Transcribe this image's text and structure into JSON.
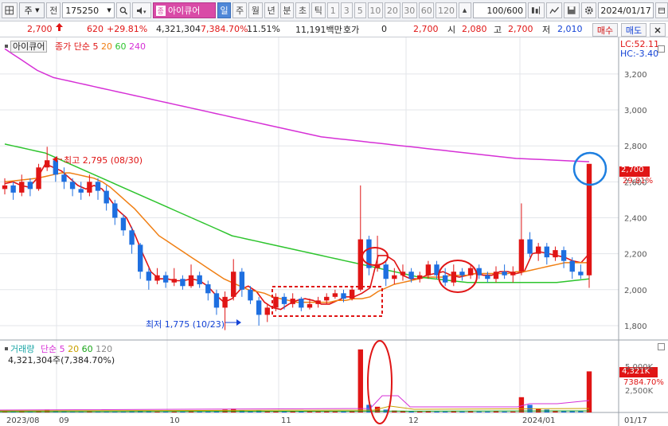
{
  "toolbar": {
    "icon_left": "grid-icon",
    "prefix1": "주",
    "prefix2": "전",
    "code": "175250",
    "name": "아이큐어",
    "periods": [
      "일",
      "주",
      "월",
      "년",
      "분",
      "초",
      "틱"
    ],
    "numbers": [
      "1",
      "3",
      "5",
      "10",
      "20",
      "30",
      "60",
      "120"
    ],
    "count": "100",
    "count_total": "/600",
    "date": "2024/01/17"
  },
  "info": {
    "price": "2,700",
    "change": "620",
    "change_pct": "+29.81%",
    "volume": "4,321,304",
    "volume_pct": "7,384.70%",
    "turnover": "11.51%",
    "amount": "11,191백만",
    "hoga_label": "호가",
    "hoga_value": "0",
    "hoga_price": "2,700",
    "open_label": "시",
    "open": "2,080",
    "high_label": "고",
    "high": "2,700",
    "low_label": "저",
    "low": "2,010",
    "buy": "매수",
    "sell": "매도"
  },
  "price_panel": {
    "stock_label": "아이큐어",
    "ma_label": "종가 단순",
    "ma_periods": [
      {
        "label": "5",
        "color": "#e01515"
      },
      {
        "label": "20",
        "color": "#f07f13"
      },
      {
        "label": "60",
        "color": "#2dc42d"
      },
      {
        "label": "240",
        "color": "#d630d6"
      }
    ],
    "lc": "LC:52.11",
    "hc": "HC:-3.40",
    "high_note": "최고 2,795 (08/30)",
    "low_note": "최저 1,775 (10/23)",
    "current_tag": "2,700",
    "current_pct": "29.81%"
  },
  "volume_panel": {
    "label": "거래량",
    "ma_label": "단순",
    "ma_periods": [
      {
        "label": "5",
        "color": "#d630d6"
      },
      {
        "label": "20",
        "color": "#c9a100"
      },
      {
        "label": "60",
        "color": "#1aa51a"
      },
      {
        "label": "120",
        "color": "#888888"
      }
    ],
    "summary": "4,321,304주(7,384.70%)",
    "tag_value": "4,321K",
    "tag_pct": "7384.70%"
  },
  "x_axis": [
    "2023/08",
    "09",
    "10",
    "11",
    "12",
    "2024/01",
    "01/17"
  ],
  "chart_data": {
    "type": "candlestick",
    "y_ticks": [
      1800,
      2000,
      2200,
      2400,
      2600,
      2800,
      3000,
      3200
    ],
    "y_tick_labels": [
      "1,800",
      "2,000",
      "2,200",
      "2,400",
      "2,600",
      "2,800",
      "3,000",
      "3,200"
    ],
    "vol_ticks": [
      "2,500K",
      "5,000K"
    ],
    "price_range": [
      1720,
      3390
    ],
    "series": [
      {
        "name": "5",
        "values": [
          2590,
          2600,
          2580,
          2570,
          2620,
          2700,
          2680,
          2660,
          2620,
          2580,
          2560,
          2580,
          2560,
          2500,
          2440,
          2400,
          2310,
          2200,
          2100,
          2060,
          2060,
          2050,
          2050,
          2060,
          2050,
          2020,
          1970,
          1930,
          1950,
          2000,
          2020,
          1990,
          1930,
          1900,
          1890,
          1920,
          1940,
          1950,
          1940,
          1920,
          1920,
          1940,
          1960,
          1960,
          1980,
          2010,
          2190,
          2190,
          2160,
          2080,
          2060,
          2060,
          2080,
          2090,
          2100,
          2080,
          2070,
          2080,
          2090,
          2080,
          2080,
          2100,
          2100,
          2090,
          2100,
          2200,
          2210,
          2200,
          2190,
          2180,
          2160,
          2150,
          2200
        ]
      },
      {
        "name": "20",
        "values": [
          2600,
          2605,
          2610,
          2615,
          2620,
          2630,
          2640,
          2650,
          2650,
          2640,
          2630,
          2620,
          2600,
          2570,
          2530,
          2490,
          2450,
          2400,
          2350,
          2300,
          2270,
          2240,
          2210,
          2180,
          2150,
          2120,
          2090,
          2060,
          2040,
          2020,
          2000,
          1990,
          1980,
          1960,
          1950,
          1940,
          1930,
          1930,
          1930,
          1930,
          1930,
          1940,
          1940,
          1950,
          1950,
          1960,
          1990,
          2010,
          2030,
          2040,
          2050,
          2060,
          2070,
          2070,
          2070,
          2080,
          2080,
          2080,
          2090,
          2090,
          2090,
          2090,
          2090,
          2100,
          2100,
          2110,
          2120,
          2130,
          2140,
          2150,
          2150,
          2150,
          2150
        ]
      },
      {
        "name": "60",
        "values": [
          2810,
          2800,
          2790,
          2780,
          2770,
          2760,
          2740,
          2720,
          2700,
          2680,
          2660,
          2640,
          2620,
          2600,
          2580,
          2560,
          2540,
          2520,
          2500,
          2480,
          2460,
          2440,
          2420,
          2400,
          2380,
          2360,
          2340,
          2320,
          2300,
          2290,
          2280,
          2270,
          2260,
          2250,
          2240,
          2230,
          2220,
          2210,
          2200,
          2190,
          2180,
          2170,
          2160,
          2150,
          2140,
          2130,
          2120,
          2110,
          2100,
          2090,
          2080,
          2070,
          2065,
          2060,
          2055,
          2050,
          2045,
          2040,
          2040,
          2040,
          2040,
          2040,
          2040,
          2040,
          2040,
          2040,
          2040,
          2040,
          2040,
          2045,
          2050,
          2055,
          2060
        ]
      },
      {
        "name": "240",
        "values": [
          3340,
          3310,
          3280,
          3250,
          3220,
          3200,
          3180,
          3170,
          3160,
          3150,
          3140,
          3130,
          3120,
          3110,
          3100,
          3090,
          3080,
          3070,
          3060,
          3050,
          3040,
          3030,
          3020,
          3010,
          3000,
          2990,
          2980,
          2970,
          2960,
          2950,
          2940,
          2930,
          2920,
          2910,
          2900,
          2890,
          2880,
          2870,
          2860,
          2850,
          2845,
          2840,
          2835,
          2830,
          2825,
          2820,
          2815,
          2810,
          2805,
          2800,
          2795,
          2790,
          2785,
          2780,
          2775,
          2770,
          2765,
          2760,
          2755,
          2750,
          2745,
          2740,
          2735,
          2730,
          2728,
          2726,
          2724,
          2722,
          2720,
          2718,
          2716,
          2714,
          2712
        ]
      }
    ],
    "candles": [
      [
        2560,
        2580,
        2620,
        2530
      ],
      [
        2580,
        2540,
        2600,
        2500
      ],
      [
        2540,
        2600,
        2640,
        2520
      ],
      [
        2600,
        2560,
        2620,
        2520
      ],
      [
        2560,
        2680,
        2700,
        2550
      ],
      [
        2680,
        2720,
        2795,
        2660
      ],
      [
        2720,
        2640,
        2740,
        2600
      ],
      [
        2640,
        2600,
        2680,
        2560
      ],
      [
        2600,
        2560,
        2620,
        2520
      ],
      [
        2560,
        2540,
        2600,
        2500
      ],
      [
        2540,
        2600,
        2640,
        2520
      ],
      [
        2600,
        2550,
        2620,
        2500
      ],
      [
        2550,
        2480,
        2580,
        2440
      ],
      [
        2480,
        2400,
        2500,
        2360
      ],
      [
        2400,
        2330,
        2420,
        2300
      ],
      [
        2330,
        2250,
        2350,
        2200
      ],
      [
        2250,
        2100,
        2260,
        2060
      ],
      [
        2100,
        2050,
        2120,
        2000
      ],
      [
        2050,
        2080,
        2120,
        2030
      ],
      [
        2080,
        2040,
        2100,
        2010
      ],
      [
        2040,
        2060,
        2120,
        2020
      ],
      [
        2060,
        2020,
        2080,
        2000
      ],
      [
        2020,
        2080,
        2140,
        2010
      ],
      [
        2080,
        2030,
        2100,
        2010
      ],
      [
        2030,
        1980,
        2050,
        1940
      ],
      [
        1980,
        1900,
        2000,
        1860
      ],
      [
        1900,
        1960,
        1990,
        1775
      ],
      [
        1960,
        2100,
        2170,
        1940
      ],
      [
        2100,
        2000,
        2120,
        1960
      ],
      [
        2000,
        1940,
        2020,
        1920
      ],
      [
        1940,
        1860,
        1960,
        1800
      ],
      [
        1860,
        1900,
        1920,
        1820
      ],
      [
        1900,
        1960,
        1980,
        1880
      ],
      [
        1960,
        1920,
        1980,
        1890
      ],
      [
        1920,
        1950,
        1980,
        1900
      ],
      [
        1950,
        1900,
        1960,
        1880
      ],
      [
        1900,
        1920,
        1950,
        1890
      ],
      [
        1920,
        1940,
        1960,
        1900
      ],
      [
        1940,
        1960,
        1980,
        1920
      ],
      [
        1960,
        1980,
        2000,
        1950
      ],
      [
        1980,
        1950,
        2000,
        1930
      ],
      [
        1950,
        2000,
        2020,
        1940
      ],
      [
        2000,
        2280,
        2580,
        1990
      ],
      [
        2280,
        2120,
        2300,
        2080
      ],
      [
        2120,
        2140,
        2300,
        2100
      ],
      [
        2140,
        2060,
        2160,
        2020
      ],
      [
        2060,
        2080,
        2120,
        2030
      ],
      [
        2080,
        2100,
        2140,
        2050
      ],
      [
        2100,
        2060,
        2120,
        2040
      ],
      [
        2060,
        2080,
        2100,
        2040
      ],
      [
        2080,
        2140,
        2160,
        2060
      ],
      [
        2140,
        2080,
        2160,
        2060
      ],
      [
        2080,
        2040,
        2120,
        2020
      ],
      [
        2040,
        2100,
        2140,
        2020
      ],
      [
        2100,
        2080,
        2120,
        2050
      ],
      [
        2080,
        2120,
        2140,
        2060
      ],
      [
        2120,
        2080,
        2140,
        2060
      ],
      [
        2080,
        2060,
        2100,
        2040
      ],
      [
        2060,
        2100,
        2130,
        2040
      ],
      [
        2100,
        2080,
        2140,
        2060
      ],
      [
        2080,
        2100,
        2130,
        2040
      ],
      [
        2100,
        2280,
        2480,
        2080
      ],
      [
        2280,
        2200,
        2320,
        2180
      ],
      [
        2200,
        2240,
        2260,
        2160
      ],
      [
        2240,
        2180,
        2260,
        2140
      ],
      [
        2180,
        2220,
        2240,
        2160
      ],
      [
        2220,
        2160,
        2240,
        2120
      ],
      [
        2160,
        2100,
        2180,
        2060
      ],
      [
        2100,
        2080,
        2140,
        2060
      ],
      [
        2080,
        2700,
        2700,
        2010
      ]
    ],
    "volumes": [
      0.15,
      0.12,
      0.18,
      0.1,
      0.2,
      0.3,
      0.2,
      0.15,
      0.12,
      0.1,
      0.15,
      0.12,
      0.1,
      0.12,
      0.1,
      0.15,
      0.2,
      0.15,
      0.12,
      0.1,
      0.12,
      0.1,
      0.15,
      0.1,
      0.12,
      0.15,
      0.3,
      0.4,
      0.25,
      0.15,
      0.2,
      0.12,
      0.12,
      0.1,
      0.1,
      0.1,
      0.08,
      0.08,
      0.1,
      0.1,
      0.1,
      0.12,
      6.6,
      0.8,
      0.6,
      0.3,
      0.2,
      0.15,
      0.12,
      0.1,
      0.12,
      0.1,
      0.1,
      0.12,
      0.1,
      0.12,
      0.1,
      0.1,
      0.12,
      0.1,
      0.1,
      1.6,
      0.8,
      0.4,
      0.3,
      0.2,
      0.15,
      0.15,
      0.2,
      4.3
    ]
  }
}
